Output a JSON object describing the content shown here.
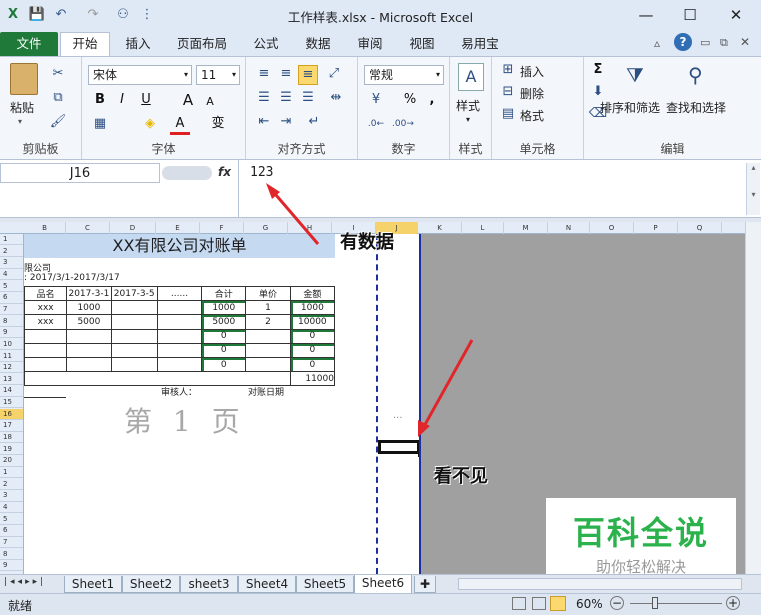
{
  "window": {
    "title": "工作样表.xlsx - Microsoft Excel",
    "minimize": "—",
    "maximize": "☐",
    "close": "✕"
  },
  "quick_access": {
    "save": "💾",
    "undo": "↶",
    "redo": "↷",
    "customize": "⋮"
  },
  "tabs": {
    "file": "文件",
    "home": "开始",
    "insert": "插入",
    "layout": "页面布局",
    "formulas": "公式",
    "data": "数据",
    "review": "审阅",
    "view": "视图",
    "addin": "易用宝"
  },
  "ribbon": {
    "clipboard": {
      "label": "剪贴板",
      "paste": "粘贴"
    },
    "font": {
      "label": "字体",
      "name": "宋体",
      "size": "11",
      "bold": "B",
      "italic": "I",
      "underline": "U",
      "grow": "A",
      "shrink": "A",
      "color": "A",
      "phonetic": "变"
    },
    "alignment": {
      "label": "对齐方式"
    },
    "number": {
      "label": "数字",
      "format": "常规",
      "percent": "%",
      "comma": ","
    },
    "styles": {
      "label": "样式",
      "button": "样式"
    },
    "cells": {
      "label": "单元格",
      "insert": "插入",
      "delete": "删除",
      "format": "格式"
    },
    "editing": {
      "label": "编辑",
      "sort": "排序和筛选",
      "find": "查找和选择",
      "sum": "Σ"
    }
  },
  "formula_bar": {
    "name_box": "J16",
    "fx": "fx",
    "value": "123"
  },
  "columns": [
    "B",
    "C",
    "D",
    "E",
    "F",
    "G",
    "H",
    "I",
    "J",
    "K",
    "L",
    "M",
    "N",
    "O",
    "P",
    "Q"
  ],
  "rows": [
    "1",
    "2",
    "3",
    "4",
    "5",
    "6",
    "7",
    "8",
    "9",
    "10",
    "11",
    "12",
    "13",
    "14",
    "15",
    "16",
    "17",
    "18",
    "19",
    "20",
    "1",
    "2",
    "3",
    "4",
    "5",
    "6",
    "7",
    "8",
    "9"
  ],
  "sheet": {
    "title": "XX有限公司对账单",
    "company": "限公司",
    "period": ": 2017/3/1-2017/3/17",
    "headers": [
      "品名",
      "2017-3-1",
      "2017-3-5",
      "......",
      "合计",
      "单价",
      "金额"
    ],
    "data_rows": [
      [
        "xxx",
        "1000",
        "",
        "",
        "1000",
        "1",
        "1000"
      ],
      [
        "xxx",
        "5000",
        "",
        "",
        "5000",
        "2",
        "10000"
      ],
      [
        "",
        "",
        "",
        "",
        "0",
        "",
        "0"
      ],
      [
        "",
        "",
        "",
        "",
        "0",
        "",
        "0"
      ],
      [
        "",
        "",
        "",
        "",
        "0",
        "",
        "0"
      ]
    ],
    "total": "11000",
    "reviewer": "审核人：",
    "date_label": "对账日期",
    "page_watermark": "第 1 页",
    "ellipsis": "..."
  },
  "annotations": {
    "has_data": "有数据",
    "invisible": "看不见"
  },
  "sheet_tabs": [
    "Sheet1",
    "Sheet2",
    "sheet3",
    "Sheet4",
    "Sheet5",
    "Sheet6"
  ],
  "active_sheet": "Sheet6",
  "status": {
    "ready": "就绪",
    "zoom": "60%",
    "minus": "−",
    "plus": "+"
  },
  "watermark": {
    "title": "百科全说",
    "subtitle": "助你轻松解决"
  },
  "colors": {
    "file_tab": "#1f7a3a",
    "arrow": "#e0262a",
    "watermark": "#2bb24c",
    "selection": "#1b2f9e"
  }
}
